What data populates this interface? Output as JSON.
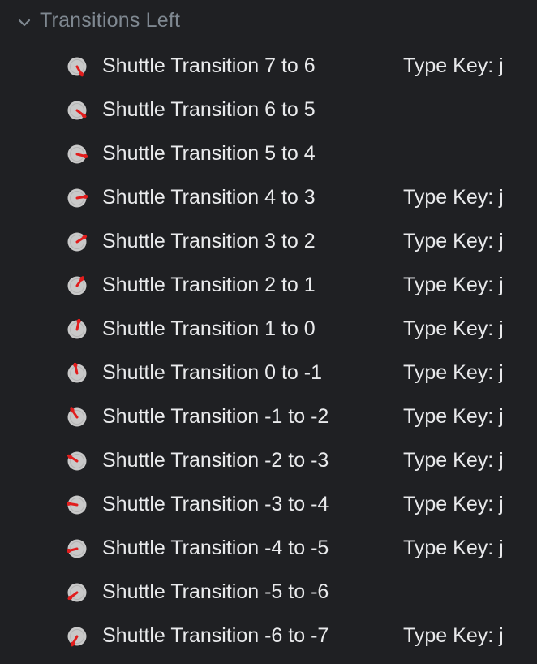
{
  "group": {
    "title": "Transitions Left",
    "icon": "chevron-down-icon"
  },
  "colors": {
    "background": "#1f2023",
    "title": "#7f8891",
    "text": "#e9eaec",
    "dial_face": "#c9c9c9",
    "dial_needle": "#e11d1d"
  },
  "rows": [
    {
      "label": "Shuttle Transition 7 to 6",
      "key": "Type Key: j",
      "icon": "shuttle-dial-icon"
    },
    {
      "label": "Shuttle Transition 6 to 5",
      "key": "",
      "icon": "shuttle-dial-icon"
    },
    {
      "label": "Shuttle Transition 5 to 4",
      "key": "",
      "icon": "shuttle-dial-icon"
    },
    {
      "label": "Shuttle Transition 4 to 3",
      "key": "Type Key: j",
      "icon": "shuttle-dial-icon"
    },
    {
      "label": "Shuttle Transition 3 to 2",
      "key": "Type Key: j",
      "icon": "shuttle-dial-icon"
    },
    {
      "label": "Shuttle Transition 2 to 1",
      "key": "Type Key: j",
      "icon": "shuttle-dial-icon"
    },
    {
      "label": "Shuttle Transition 1 to 0",
      "key": "Type Key: j",
      "icon": "shuttle-dial-icon"
    },
    {
      "label": "Shuttle Transition 0 to -1",
      "key": "Type Key: j",
      "icon": "shuttle-dial-icon"
    },
    {
      "label": "Shuttle Transition -1 to -2",
      "key": "Type Key: j",
      "icon": "shuttle-dial-icon"
    },
    {
      "label": "Shuttle Transition -2 to -3",
      "key": "Type Key: j",
      "icon": "shuttle-dial-icon"
    },
    {
      "label": "Shuttle Transition -3 to -4",
      "key": "Type Key: j",
      "icon": "shuttle-dial-icon"
    },
    {
      "label": "Shuttle Transition -4 to -5",
      "key": "Type Key: j",
      "icon": "shuttle-dial-icon"
    },
    {
      "label": "Shuttle Transition -5 to -6",
      "key": "",
      "icon": "shuttle-dial-icon"
    },
    {
      "label": "Shuttle Transition -6 to -7",
      "key": "Type Key: j",
      "icon": "shuttle-dial-icon"
    }
  ]
}
